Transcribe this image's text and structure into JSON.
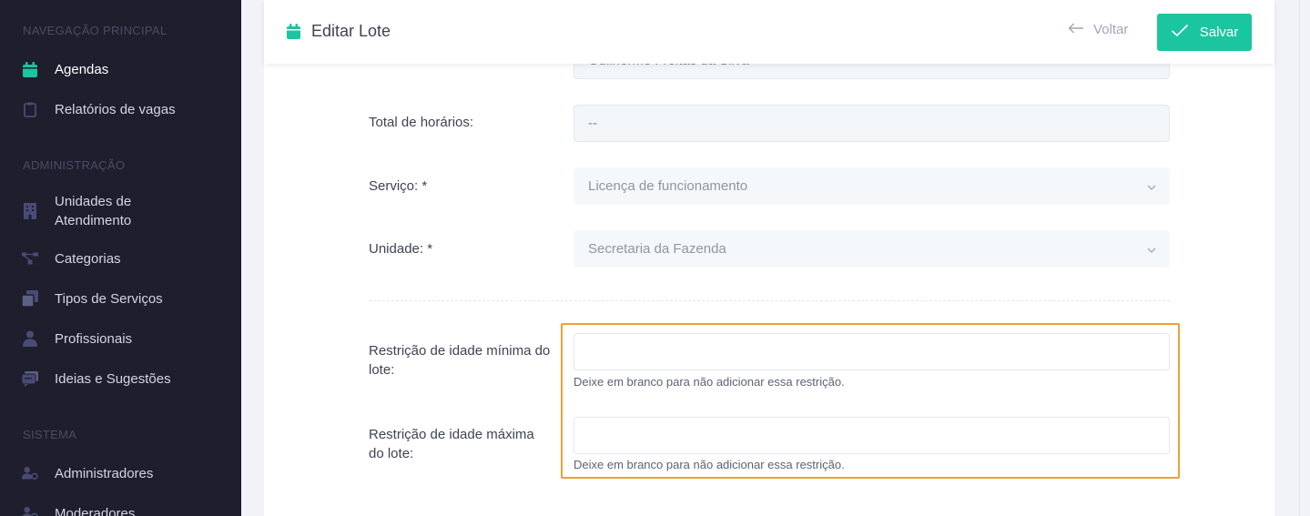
{
  "sidebar": {
    "sections": [
      {
        "title": "NAVEGAÇÃO PRINCIPAL"
      },
      {
        "title": "ADMINISTRAÇÃO"
      },
      {
        "title": "SISTEMA"
      }
    ],
    "items": [
      {
        "label": "Agendas",
        "icon": "calendar-icon",
        "active": true
      },
      {
        "label": "Relatórios de vagas",
        "icon": "clipboard-icon"
      },
      {
        "label": "Unidades de Atendimento",
        "icon": "building-icon"
      },
      {
        "label": "Categorias",
        "icon": "hierarchy-icon"
      },
      {
        "label": "Tipos de Serviços",
        "icon": "layers-icon"
      },
      {
        "label": "Profissionais",
        "icon": "professional-icon"
      },
      {
        "label": "Ideias e Sugestões",
        "icon": "chat-icon"
      },
      {
        "label": "Administradores",
        "icon": "user-cog-icon"
      },
      {
        "label": "Moderadores",
        "icon": "user-cog-icon"
      }
    ]
  },
  "header": {
    "title": "Editar Lote",
    "back_label": "Voltar",
    "save_label": "Salvar"
  },
  "form": {
    "partial_value": "Guilherme Freitas da Silva",
    "total_horarios": {
      "label": "Total de horários:",
      "value": "--"
    },
    "servico": {
      "label": "Serviço: *",
      "value": "Licença de funcionamento"
    },
    "unidade": {
      "label": "Unidade: *",
      "value": "Secretaria da Fazenda"
    },
    "idade_minima": {
      "label": "Restrição de idade mínima do lote:",
      "value": "",
      "help": "Deixe em branco para não adicionar essa restrição."
    },
    "idade_maxima": {
      "label": "Restrição de idade máxima do lote:",
      "value": "",
      "help": "Deixe em branco para não adicionar essa restrição."
    }
  },
  "colors": {
    "sidebar_bg": "#1e1e2d",
    "accent": "#1bc5a0",
    "highlight": "#f0a030"
  }
}
